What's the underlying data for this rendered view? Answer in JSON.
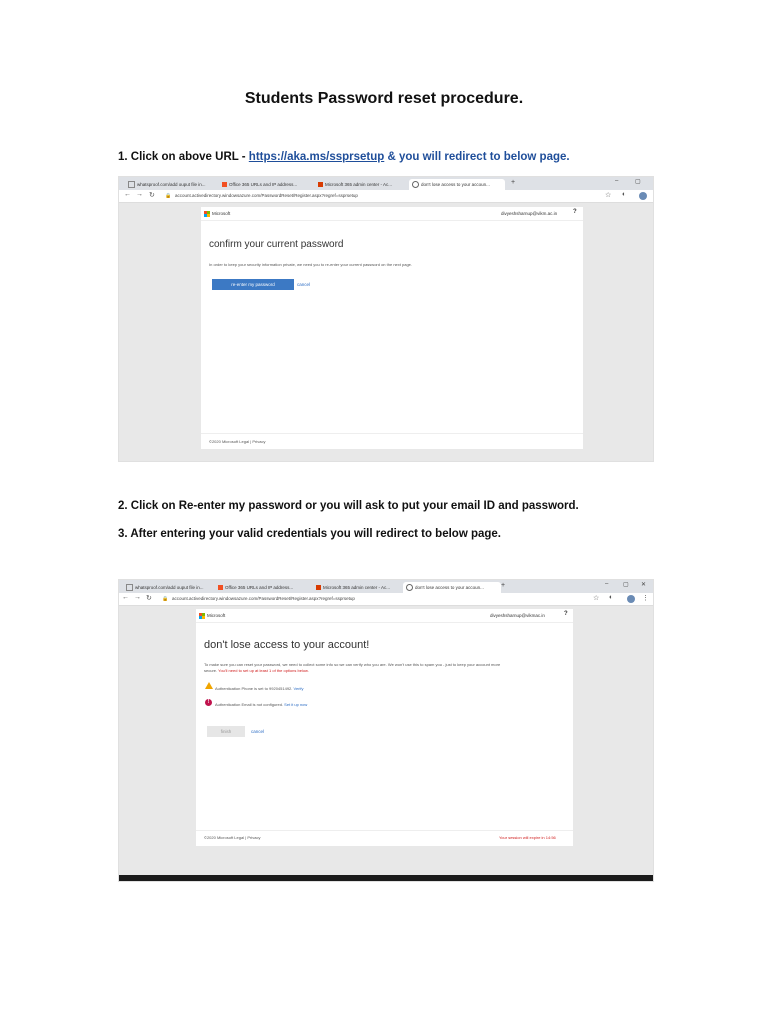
{
  "document": {
    "title": "Students Password reset procedure.",
    "step1": {
      "prefix": "1. Click on above URL - ",
      "link": "https://aka.ms/ssprsetup",
      "suffix": " & you will redirect to below page."
    },
    "step2": "2. Click on Re-enter my password or you will ask to put your email ID and password.",
    "step3": "3. After entering your valid credentials you will redirect to below page."
  },
  "screenshot1": {
    "tabs": [
      "whatsproof.com/add ouput file in...",
      "Office 365 URLs and IP address...",
      "Microsoft 365 admin center - Ac...",
      "don't lose access to your accoun..."
    ],
    "url": "account.activedirectory.windowsazure.com/PasswordReset/Register.aspx?regref=ssprsetup",
    "brand": "Microsoft",
    "account": "divyeshsharnup@vikm.ac.in",
    "help": "?",
    "heading": "confirm your current password",
    "description": "In order to keep your security information private, we need you to re-enter your current password on the next page.",
    "primary_button": "re-enter my password",
    "cancel": "cancel",
    "footer": "©2020 Microsoft   Legal   |   Privacy"
  },
  "screenshot2": {
    "tabs": [
      "whatsproof.com/add ouput file in...",
      "Office 365 URLs and IP address...",
      "Microsoft 365 admin center - Ac...",
      "don't lose access to your accoun..."
    ],
    "url": "account.activedirectory.windowsazure.com/PasswordReset/Register.aspx?regref=ssprsetup",
    "brand": "Microsoft",
    "account": "divyeshsharnup@vikmac.in",
    "help": "?",
    "heading": "don't lose access to your account!",
    "description_line1": "To make sure you can reset your password, we need to collect some info so we can verify who you are. We won't use this to spam you - just to keep your account more",
    "description_line2_prefix": "secure. ",
    "description_line2_red": "You'll need to set up at least 1 of the options below.",
    "phone_text": "Authentication Phone is set to 9920451492.",
    "phone_link": "Verify",
    "email_text": "Authentication Email is not configured.",
    "email_link": "Set it up now",
    "finish_button": "finish",
    "cancel": "cancel",
    "footer": "©2020 Microsoft   Legal   |   Privacy",
    "session_warning": "Your session will expire in 14:56"
  }
}
